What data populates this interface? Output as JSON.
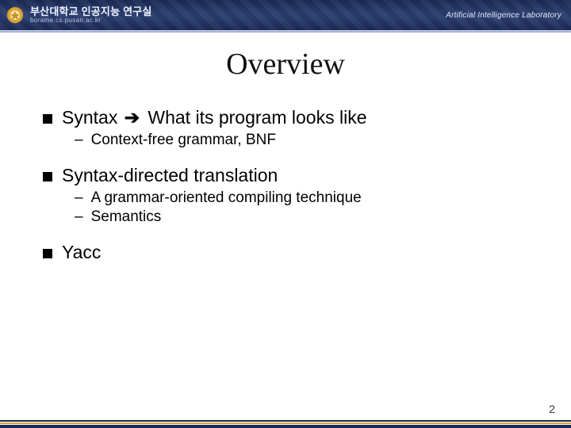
{
  "header": {
    "org_ko": "부산대학교 인공지능 연구실",
    "subdomain": "borame.cs.pusan.ac.kr",
    "lab_en": "Artificial Intelligence Laboratory"
  },
  "title": "Overview",
  "bullets": {
    "b1_pre": "Syntax ",
    "b1_arrow": "➔",
    "b1_post": " What its program looks like",
    "b1_sub1": "Context-free grammar, BNF",
    "b2": "Syntax-directed translation",
    "b2_sub1": "A grammar-oriented compiling technique",
    "b2_sub2": "Semantics",
    "b3": "Yacc"
  },
  "page_number": "2"
}
